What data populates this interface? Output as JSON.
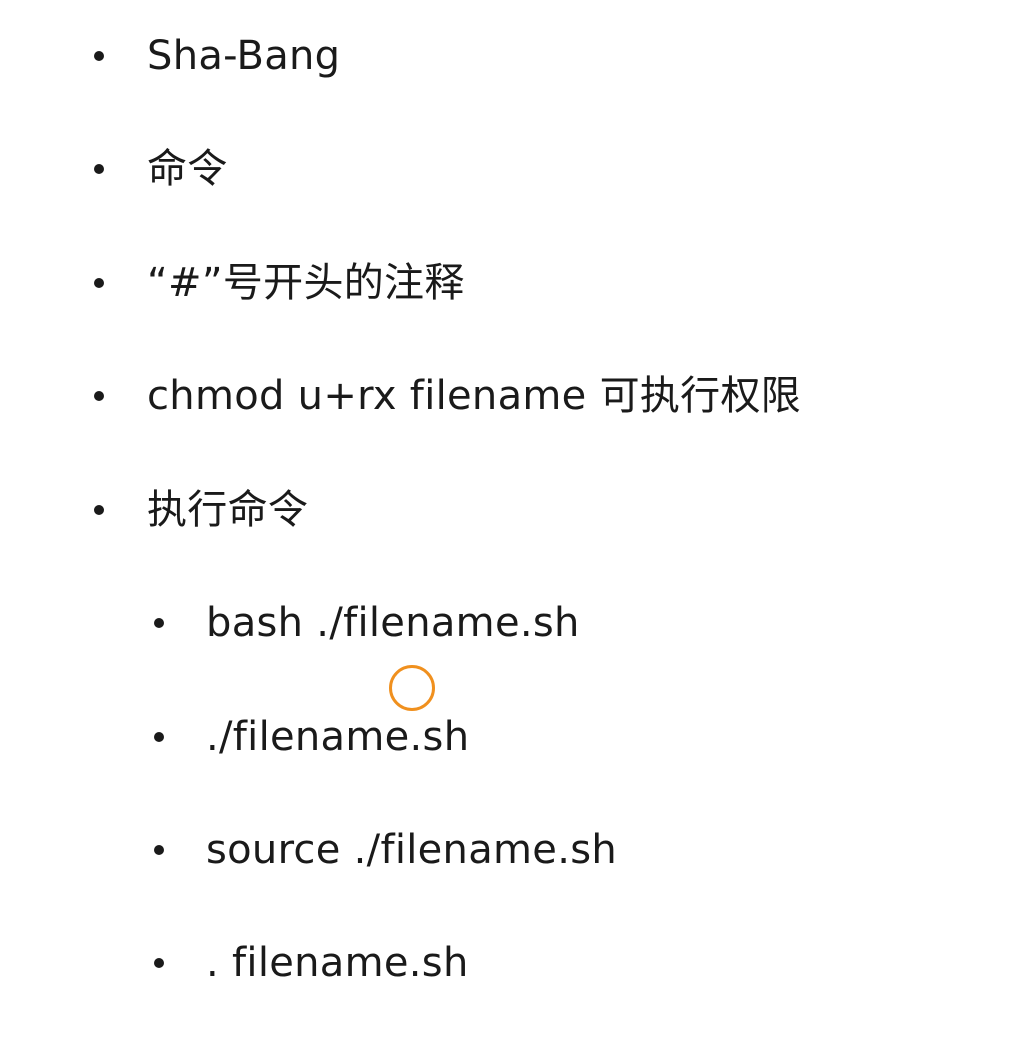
{
  "list": {
    "items": [
      {
        "label": "Sha-Bang"
      },
      {
        "label": "命令"
      },
      {
        "label": "“#”号开头的注释"
      },
      {
        "label": "chmod u+rx filename 可执行权限"
      },
      {
        "label": "执行命令",
        "children": [
          {
            "label": "bash ./filename.sh"
          },
          {
            "label": "./filename.sh"
          },
          {
            "label": "source ./filename.sh"
          },
          {
            "label": ". filename.sh"
          }
        ]
      }
    ]
  },
  "cursor": {
    "icon": "cursor-ring-icon",
    "color": "#f0901e"
  }
}
